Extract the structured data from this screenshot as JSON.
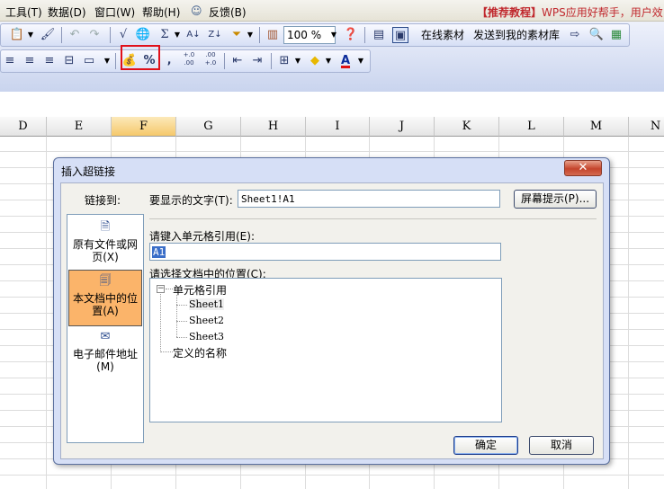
{
  "menubar": {
    "items": [
      "工具(T)",
      "数据(D)",
      "窗口(W)",
      "帮助(H)",
      "反馈(B)"
    ],
    "promo_tag": "【推荐教程】",
    "promo_text": "WPS应用好帮手，用户效"
  },
  "toolbar": {
    "zoom": "100 %",
    "online_material": "在线素材",
    "send_material": "发送到我的素材库",
    "percent": "%",
    "comma": "‚",
    "inc_decimal": "+.0\n.00",
    "dec_decimal": ".00\n+.0",
    "icons": [
      "paste-icon",
      "format-painter-icon",
      "undo-icon",
      "redo-icon",
      "sqrt-icon",
      "hyperlink-icon",
      "sum-icon",
      "sort-asc-icon",
      "sort-desc-icon",
      "filter-icon",
      "chart-icon",
      "help-icon"
    ]
  },
  "grid": {
    "columns": [
      "D",
      "E",
      "F",
      "G",
      "H",
      "I",
      "J",
      "K",
      "L",
      "M",
      "N"
    ],
    "active_column": "F"
  },
  "dialog": {
    "title": "插入超链接",
    "close": "✕",
    "link_to_label": "链接到:",
    "side_items": [
      "原有文件或网页(X)",
      "本文档中的位置(A)",
      "电子邮件地址(M)"
    ],
    "side_item_lines": [
      [
        "原有文件或网",
        "页(X)"
      ],
      [
        "本文档中的位",
        "置(A)"
      ],
      [
        "电子邮件地址",
        "(M)"
      ]
    ],
    "display_text_label": "要显示的文字(T):",
    "display_text_value": "Sheet1!A1",
    "screen_tip_button": "屏幕提示(P)...",
    "cell_ref_label": "请键入单元格引用(E):",
    "cell_ref_value": "A1",
    "location_label": "请选择文档中的位置(C):",
    "tree": {
      "root": "单元格引用",
      "root_toggle": "−",
      "sheets": [
        "Sheet1",
        "Sheet2",
        "Sheet3"
      ],
      "defined_names": "定义的名称"
    },
    "ok": "确定",
    "cancel": "取消"
  }
}
